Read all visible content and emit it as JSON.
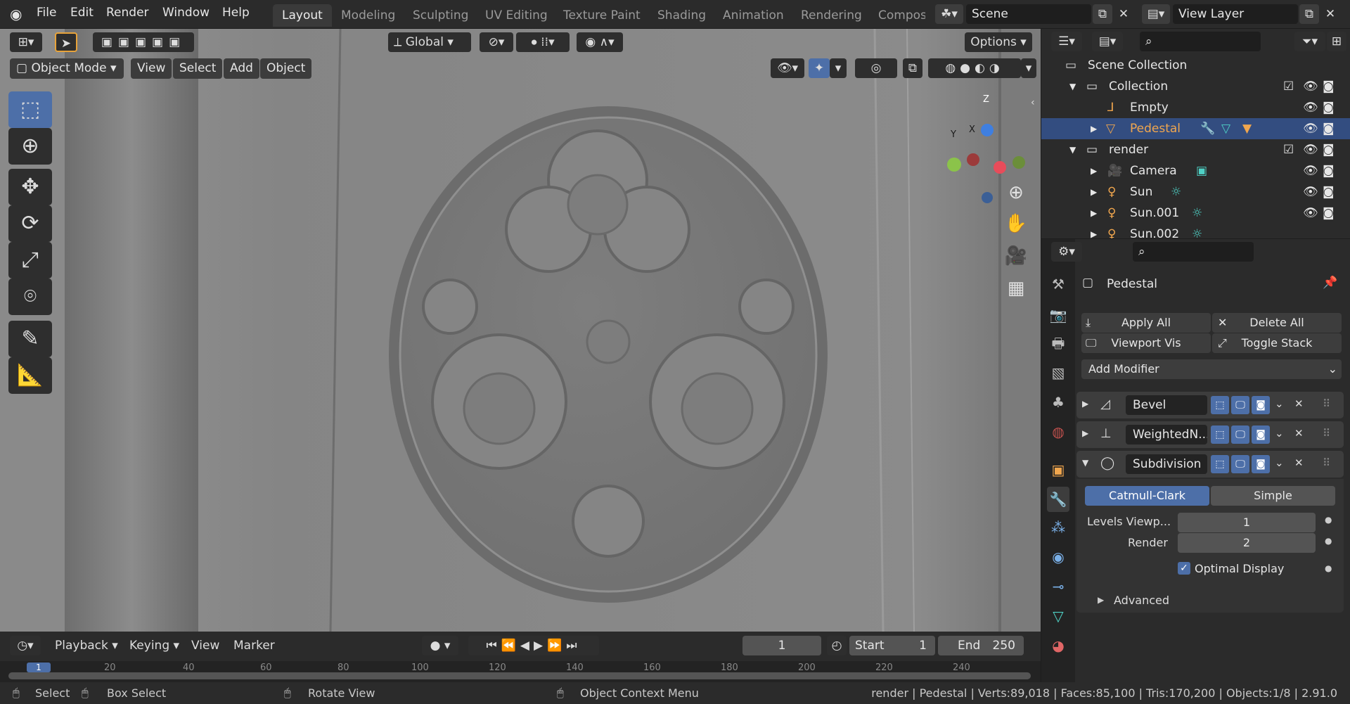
{
  "menu": [
    "File",
    "Edit",
    "Render",
    "Window",
    "Help"
  ],
  "workspaces": [
    "Layout",
    "Modeling",
    "Sculpting",
    "UV Editing",
    "Texture Paint",
    "Shading",
    "Animation",
    "Rendering",
    "Compos"
  ],
  "active_workspace": "Layout",
  "scene": "Scene",
  "view_layer": "View Layer",
  "viewport": {
    "transform_orientation": "Global",
    "options": "Options",
    "mode": "Object Mode",
    "menus": [
      "View",
      "Select",
      "Add",
      "Object"
    ],
    "gizmo": {
      "x": "X",
      "y": "Y",
      "z": "Z"
    }
  },
  "outliner": {
    "rows": [
      {
        "label": "Scene Collection",
        "icon": "scene-collection-icon"
      },
      {
        "label": "Collection",
        "icon": "collection-icon"
      },
      {
        "label": "Empty",
        "icon": "empty-icon"
      },
      {
        "label": "Pedestal",
        "icon": "mesh-icon",
        "selected": true
      },
      {
        "label": "render",
        "icon": "collection-icon"
      },
      {
        "label": "Camera",
        "icon": "camera-icon"
      },
      {
        "label": "Sun",
        "icon": "light-icon"
      },
      {
        "label": "Sun.001",
        "icon": "light-icon"
      },
      {
        "label": "Sun.002",
        "icon": "light-icon"
      }
    ]
  },
  "properties": {
    "object_name": "Pedestal",
    "apply_all": "Apply All",
    "delete_all": "Delete All",
    "viewport_vis": "Viewport Vis",
    "toggle_stack": "Toggle Stack",
    "add_modifier": "Add Modifier",
    "modifiers": [
      {
        "name": "Bevel",
        "expanded": false
      },
      {
        "name": "WeightedN...",
        "expanded": false
      },
      {
        "name": "Subdivision",
        "expanded": true
      }
    ],
    "subdivision": {
      "catmull_clark": "Catmull-Clark",
      "simple": "Simple",
      "levels_viewport_label": "Levels Viewp...",
      "levels_viewport": "1",
      "render_label": "Render",
      "render": "2",
      "optimal_display": "Optimal Display",
      "advanced": "Advanced"
    }
  },
  "timeline": {
    "menus": [
      "Playback",
      "Keying",
      "View",
      "Marker"
    ],
    "current_frame": "1",
    "start_label": "Start",
    "start": "1",
    "end_label": "End",
    "end": "250",
    "ruler": [
      "1",
      "20",
      "40",
      "60",
      "80",
      "100",
      "120",
      "140",
      "160",
      "180",
      "200",
      "220",
      "240"
    ]
  },
  "status": {
    "select": "Select",
    "box_select": "Box Select",
    "rotate_view": "Rotate View",
    "context_menu": "Object Context Menu",
    "info": "render | Pedestal | Verts:89,018 | Faces:85,100 | Tris:170,200 | Objects:1/8 | 2.91.0"
  },
  "colors": {
    "accent": "#4d6fa8",
    "selected_row": "#334d80",
    "active_object": "#f0a64e",
    "viewport_bg": "#7d7d7d"
  }
}
